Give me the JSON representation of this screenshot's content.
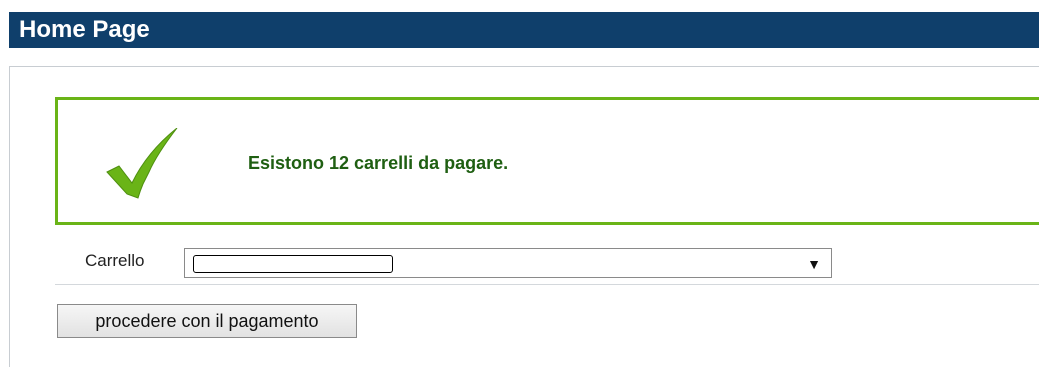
{
  "header": {
    "title": "Home Page"
  },
  "alert": {
    "icon": "checkmark-icon",
    "message": "Esistono 12 carrelli da pagare.",
    "border_color": "#6ab417",
    "text_color": "#1f5f12"
  },
  "cart_row": {
    "label": "Carrello",
    "selected_value": "",
    "arrow_glyph": "▼"
  },
  "actions": {
    "pay_label": "procedere con il pagamento"
  },
  "colors": {
    "header_background": "#0f3f6b",
    "header_text": "#ffffff"
  }
}
